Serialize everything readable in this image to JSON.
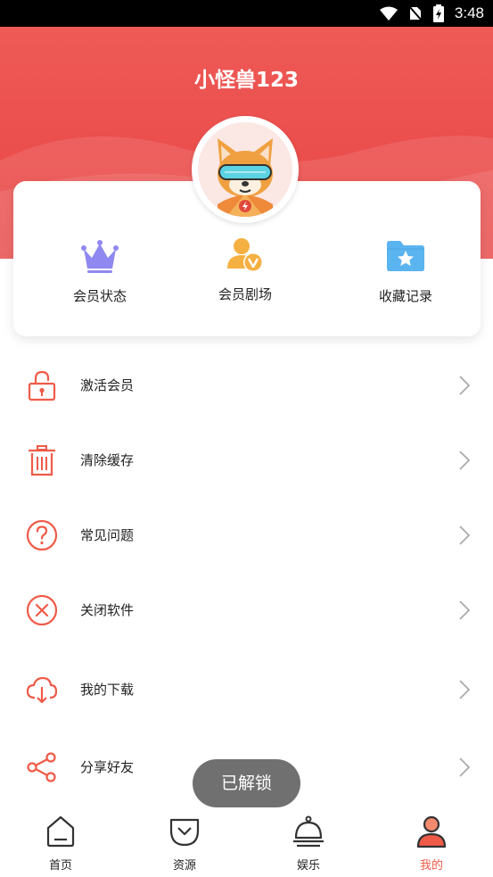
{
  "status_bar": {
    "time": "3:48"
  },
  "profile": {
    "username": "小怪兽123"
  },
  "quick_actions": [
    {
      "label": "会员状态",
      "icon": "crown-icon"
    },
    {
      "label": "会员剧场",
      "icon": "vip-user-icon"
    },
    {
      "label": "收藏记录",
      "icon": "folder-star-icon"
    }
  ],
  "menu": [
    {
      "label": "激活会员",
      "icon": "unlock-icon"
    },
    {
      "label": "清除缓存",
      "icon": "trash-icon"
    },
    {
      "label": "常见问题",
      "icon": "question-icon"
    },
    {
      "label": "关闭软件",
      "icon": "close-circle-icon"
    },
    {
      "label": "我的下载",
      "icon": "cloud-download-icon"
    },
    {
      "label": "分享好友",
      "icon": "share-icon"
    }
  ],
  "toast": {
    "text": "已解锁"
  },
  "tabbar": [
    {
      "label": "首页",
      "icon": "home-icon",
      "active": false
    },
    {
      "label": "资源",
      "icon": "resource-icon",
      "active": false
    },
    {
      "label": "娱乐",
      "icon": "cloche-icon",
      "active": false
    },
    {
      "label": "我的",
      "icon": "person-icon",
      "active": true
    }
  ],
  "colors": {
    "brand_red": "#e84a48",
    "accent_orange": "#ef5b48",
    "icon_purple": "#8f88f0",
    "icon_gold": "#f5b042",
    "icon_blue": "#5ab4f0"
  }
}
